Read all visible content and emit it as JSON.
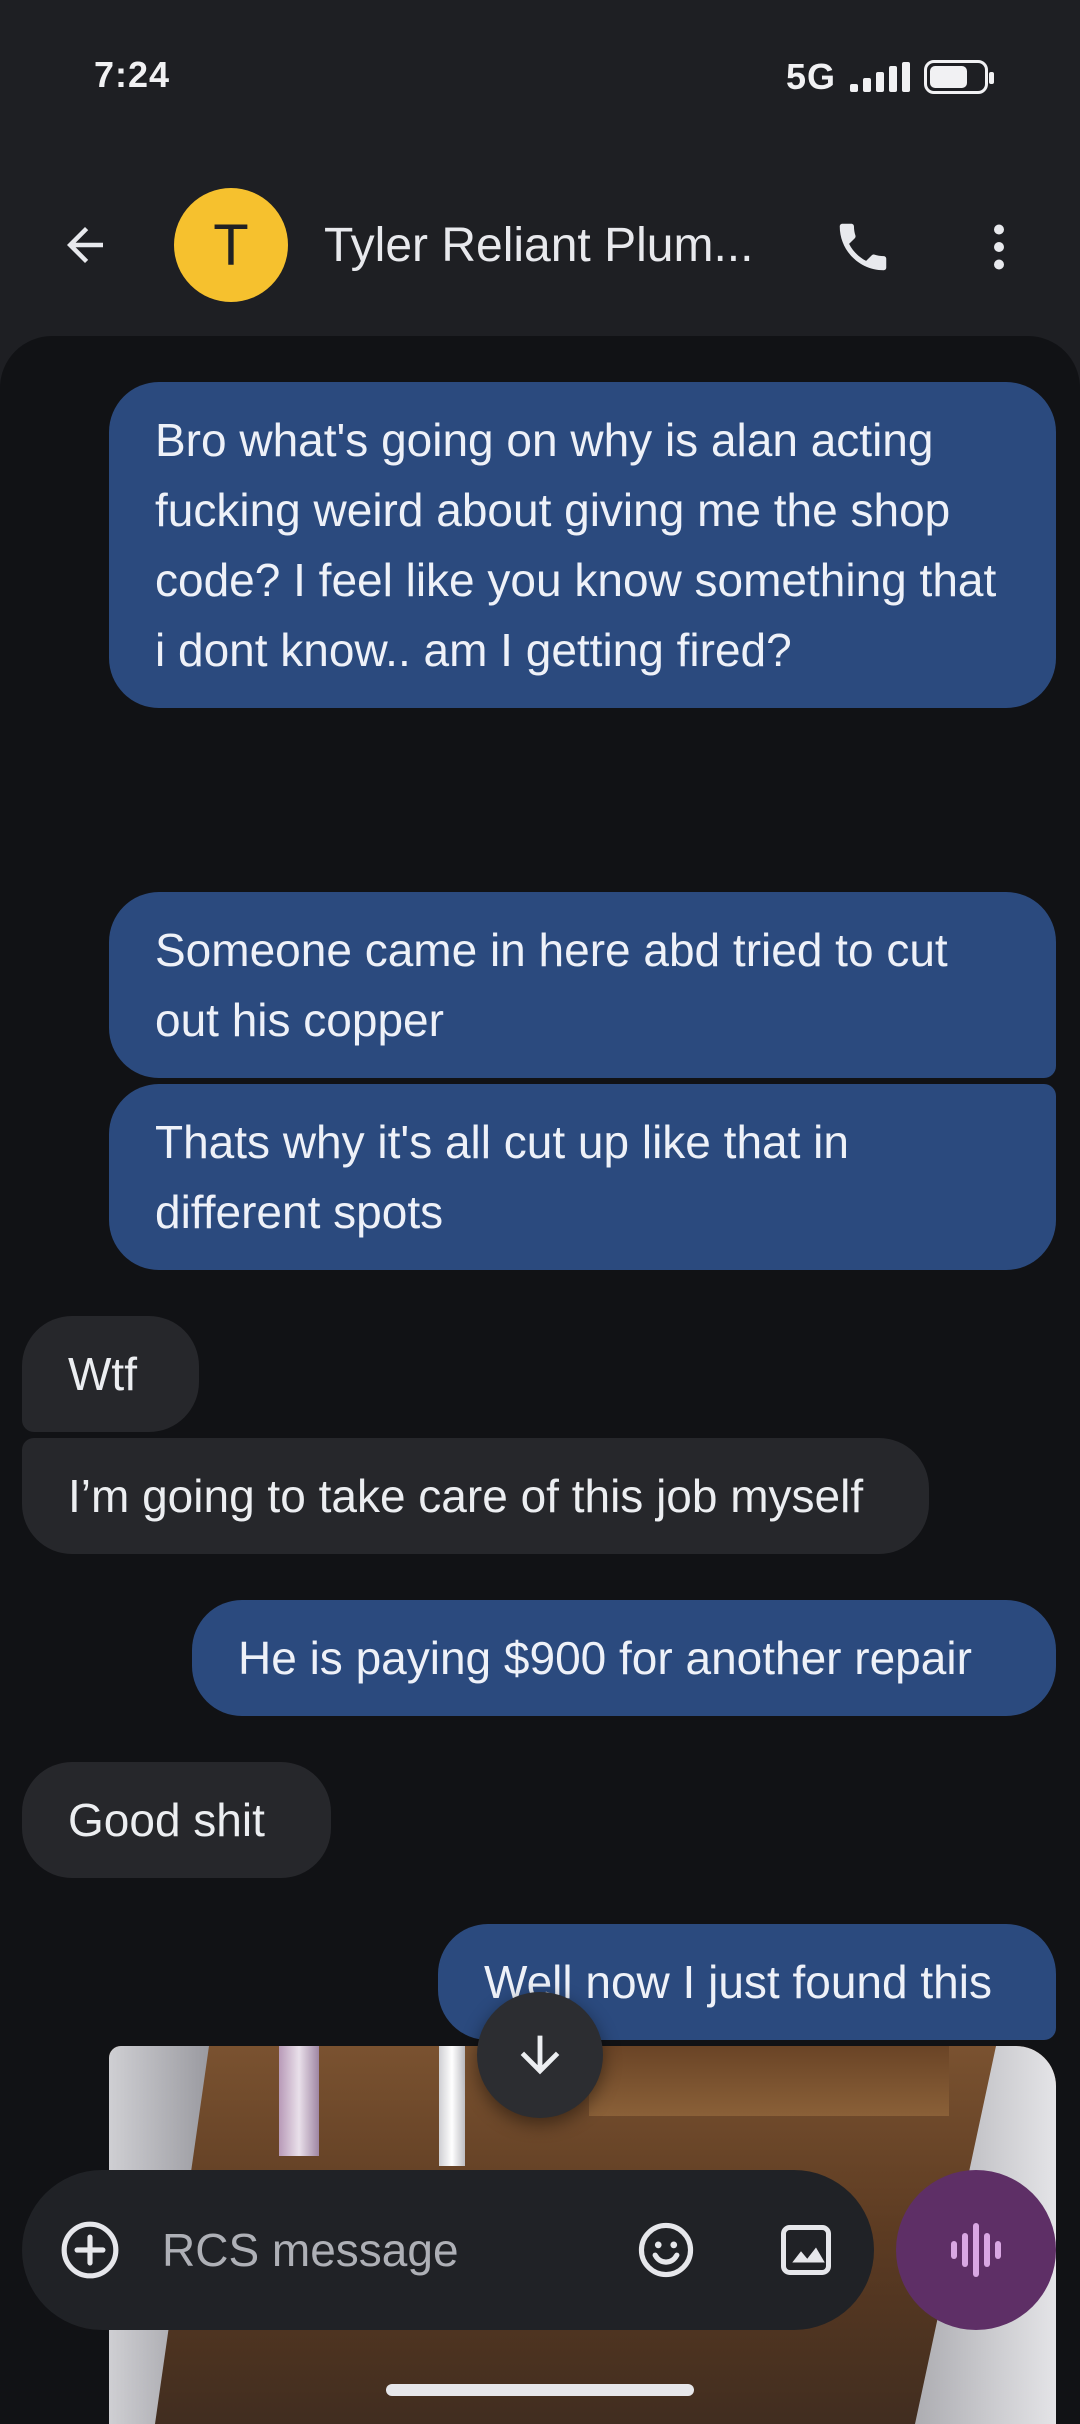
{
  "status_bar": {
    "time": "7:24",
    "network": "5G",
    "battery_level": 0.72
  },
  "header": {
    "avatar_letter": "T",
    "contact_name": "Tyler Reliant Plum...",
    "accent_color": "#f6c12e"
  },
  "messages": [
    {
      "sender": "me",
      "text": "Bro what's going on why is alan acting fucking weird about giving me the shop code? I feel like you know something that i dont know..  am I getting fired?"
    },
    {
      "sender": "me",
      "text": "Someone came in here abd tried to cut out his copper"
    },
    {
      "sender": "me",
      "text": "Thats why it's all cut up like that in different spots"
    },
    {
      "sender": "them",
      "text": "Wtf"
    },
    {
      "sender": "them",
      "text": "I’m going to take care of this job myself"
    },
    {
      "sender": "me",
      "text": "He is paying $900 for another repair"
    },
    {
      "sender": "them",
      "text": "Good shit"
    },
    {
      "sender": "me",
      "text": "Well now I just found this"
    }
  ],
  "compose": {
    "placeholder": "RCS message",
    "value": ""
  },
  "colors": {
    "sent_bubble": "#2b4a7e",
    "received_bubble": "#26272b",
    "voice_button": "#5e2f66",
    "voice_icon": "#d9a7e3"
  },
  "icons": [
    "back-arrow-icon",
    "phone-icon",
    "more-vert-icon",
    "arrow-down-icon",
    "add-circle-icon",
    "emoji-icon",
    "image-icon",
    "voice-wave-icon"
  ]
}
